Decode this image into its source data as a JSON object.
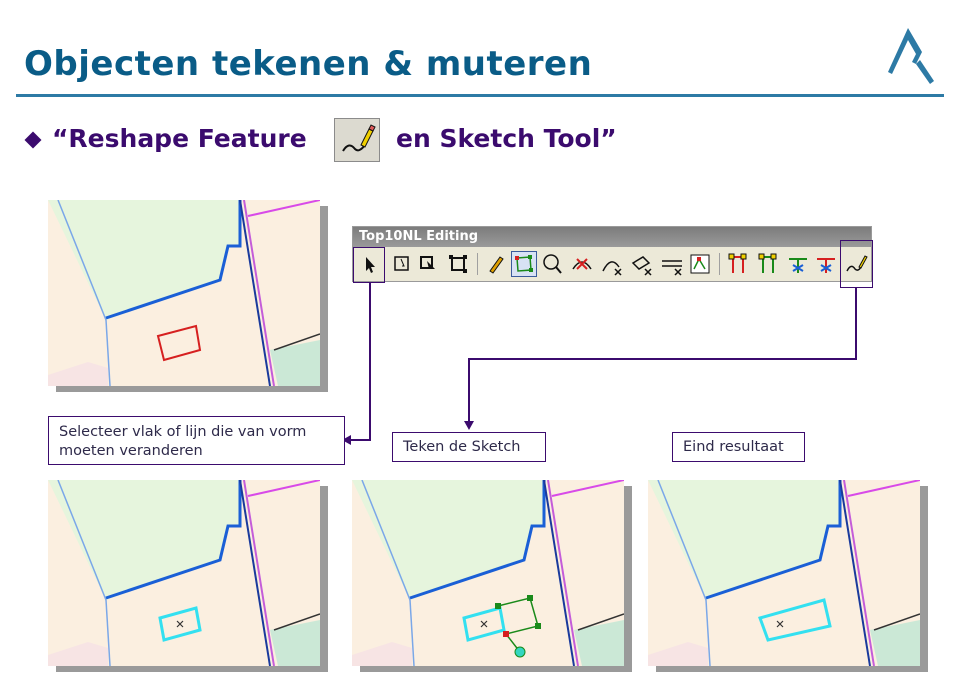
{
  "slide": {
    "title": "Objecten tekenen & muteren",
    "subtitle_part1": "“Reshape Feature",
    "subtitle_part2": "en Sketch Tool”",
    "logo_icon": "company-logo-icon",
    "accent_color": "#0a5c87",
    "text_color": "#3b0b6e"
  },
  "toolbar": {
    "title": "Top10NL Editing",
    "tools": [
      "select-arrow-icon",
      "edit-vertices-icon",
      "move-feature-icon",
      "transform-feature-icon",
      "pencil-icon",
      "sketch-polygon-icon",
      "lasso-select-icon",
      "delete-line-icon",
      "arc-icon",
      "split-feature-icon",
      "cut-line-icon",
      "vertex-edit-icon",
      "merge-icon",
      "union-icon",
      "split-polygon-icon",
      "clip-icon",
      "reshape-feature-icon"
    ]
  },
  "notes": {
    "select": "Selecteer vlak of lijn die van vorm moeten veranderen",
    "sketch": "Teken de Sketch",
    "result": "Eind resultaat"
  },
  "maps": [
    {
      "label": "selected-feature-map"
    },
    {
      "label": "selection-result-map"
    },
    {
      "label": "sketch-map"
    },
    {
      "label": "final-result-map"
    }
  ]
}
